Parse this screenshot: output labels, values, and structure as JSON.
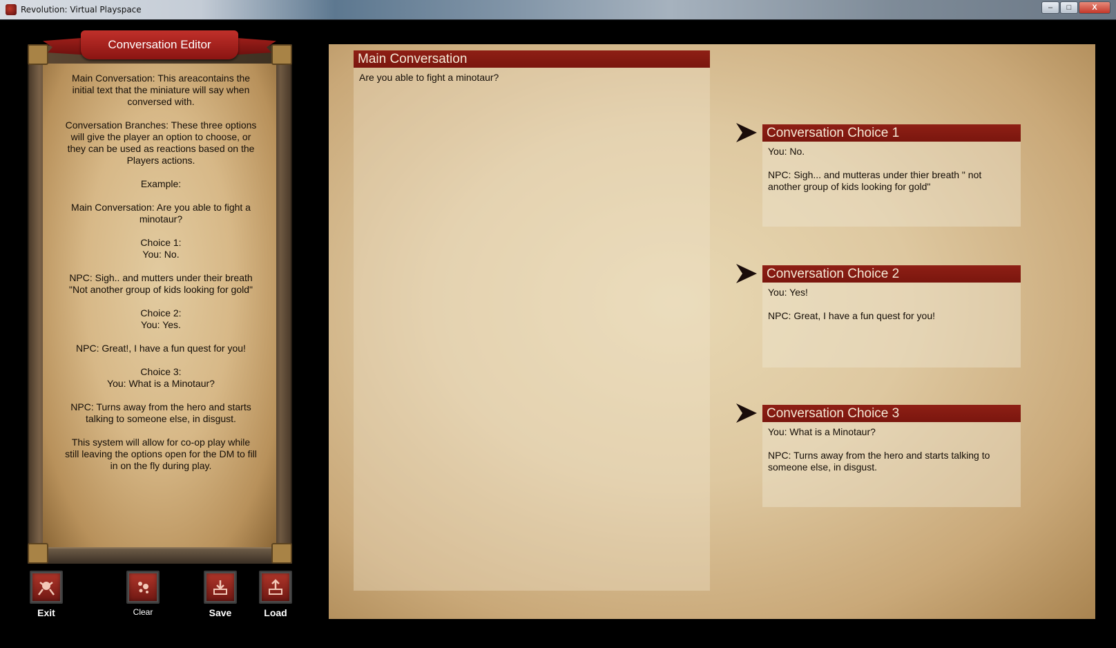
{
  "window": {
    "title": "Revolution: Virtual Playspace",
    "minimize": "–",
    "maximize": "□",
    "close": "X"
  },
  "editor": {
    "title": "Conversation Editor",
    "instructions": [
      "Main Conversation: This areacontains the initial text that the miniature will say when conversed with.",
      "Conversation Branches: These three options will give the player an option to choose, or they can be used as reactions based on the Players actions.",
      "Example:",
      "Main Conversation: Are you able to fight a minotaur?",
      "Choice 1:\nYou: No.",
      "NPC: Sigh.. and mutters under their breath \"Not another group of kids looking for gold\"",
      "Choice 2:\nYou: Yes.",
      "NPC: Great!, I have a fun quest for you!",
      "Choice 3:\nYou: What is a Minotaur?",
      "NPC: Turns away from the hero and starts talking to someone else, in disgust.",
      "This system will allow for co-op play while still leaving the options open for the DM to fill in on the fly during play."
    ]
  },
  "toolbar": {
    "exit_label": "Exit",
    "clear_label": "Clear",
    "save_label": "Save",
    "load_label": "Load"
  },
  "main_conversation": {
    "title": "Main Conversation",
    "text": "Are you able to fight a minotaur?"
  },
  "choices": [
    {
      "title": "Conversation Choice 1",
      "you": "You: No.",
      "npc": "NPC: Sigh... and mutteras under thier breath \" not another group of kids looking for gold\""
    },
    {
      "title": "Conversation Choice 2",
      "you": "You: Yes!",
      "npc": "NPC: Great, I have a fun quest for you!"
    },
    {
      "title": "Conversation Choice 3",
      "you": "You: What is a Minotaur?",
      "npc": "NPC: Turns away from the hero and starts talking to someone else, in disgust."
    }
  ],
  "colors": {
    "header_red": "#8e1f15",
    "parchment": "#dec8a0",
    "text": "#140d06"
  }
}
